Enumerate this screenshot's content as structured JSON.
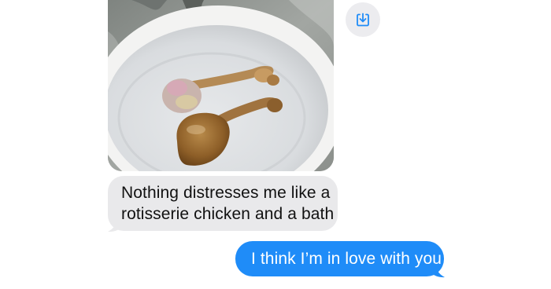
{
  "thread": {
    "attachment": {
      "kind": "photo",
      "subject": "two-chicken-drumsticks-on-plate",
      "save_icon": "download-icon",
      "accent_color": "#1f8cf8"
    },
    "messages": [
      {
        "direction": "received",
        "lines": [
          "Nothing distresses me like a",
          "rotisserie chicken and a bath"
        ],
        "bubble_color": "#e9e9eb",
        "text_color": "#111111"
      },
      {
        "direction": "sent",
        "lines": [
          "I think I’m in love with you"
        ],
        "bubble_color": "#1f8cf8",
        "text_color": "#ffffff"
      }
    ]
  }
}
